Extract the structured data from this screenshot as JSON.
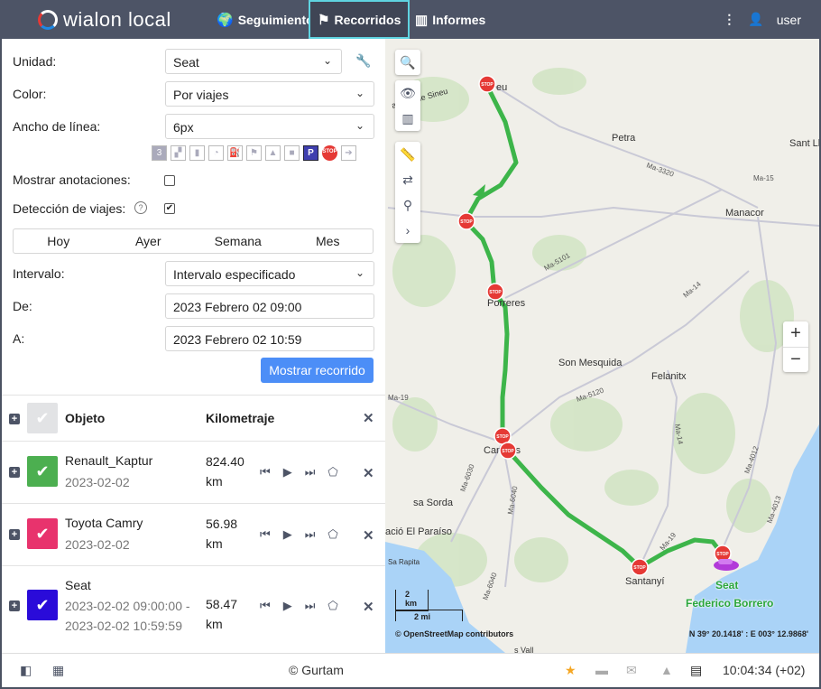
{
  "header": {
    "logo": "wialon local",
    "nav": [
      {
        "label": "Seguimiento",
        "icon": "globe-icon"
      },
      {
        "label": "Recorridos",
        "icon": "checkered-flag-icon",
        "active": true
      },
      {
        "label": "Informes",
        "icon": "report-icon"
      }
    ],
    "user": "user"
  },
  "form": {
    "unit_label": "Unidad:",
    "unit_value": "Seat",
    "color_label": "Color:",
    "color_value": "Por viajes",
    "width_label": "Ancho de línea:",
    "width_value": "6px",
    "tools": [
      "3",
      "events",
      "fuel",
      "speed",
      "fuel-station",
      "flag",
      "image",
      "video",
      "P",
      "STOP",
      "arrow"
    ],
    "annotations_label": "Mostrar anotaciones:",
    "annotations_checked": false,
    "trips_label": "Detección de viajes:",
    "trips_checked": true,
    "periods": [
      "Hoy",
      "Ayer",
      "Semana",
      "Mes"
    ],
    "interval_label": "Intervalo:",
    "interval_value": "Intervalo especificado",
    "from_label": "De:",
    "from_value": "2023 Febrero 02 09:00",
    "to_label": "A:",
    "to_value": "2023 Febrero 02 10:59",
    "submit": "Mostrar recorrido"
  },
  "table": {
    "col_object": "Objeto",
    "col_km": "Kilometraje",
    "rows": [
      {
        "name": "Renault_Kaptur",
        "date": "2023-02-02",
        "km": "824.40",
        "unit": "km",
        "color": "#4caf50"
      },
      {
        "name": "Toyota Camry",
        "date": "2023-02-02",
        "km": "56.98",
        "unit": "km",
        "color": "#e8336d"
      },
      {
        "name": "Seat",
        "date": "2023-02-02 09:00:00 -",
        "date2": "2023-02-02 10:59:59",
        "km": "58.47",
        "unit": "km",
        "color": "#2a0bd9"
      }
    ]
  },
  "map": {
    "places": [
      "Petra",
      "Sant Ll",
      "Manacor",
      "Son Mesquida",
      "Felanitx",
      "Santanyí",
      "sa Sorda",
      "ació El Paraíso",
      "Porreres",
      "Campos",
      "a vella de Sineu",
      "eu",
      "Sa Rapita",
      "s Vall"
    ],
    "roads": [
      "Ma-3320",
      "Ma-15",
      "Ma-5101",
      "Ma-14",
      "Ma-5120",
      "Ma-19",
      "Ma-6030",
      "Ma-6040",
      "Ma-4012",
      "Ma-4013",
      "Ma-14",
      "Ma-19",
      "Ma-6040"
    ],
    "stop_label": "STOP",
    "vehicle_name": "Seat",
    "driver": "Federico Borrero",
    "scale_km": "2 km",
    "scale_mi": "2 mi",
    "attribution": "© OpenStreetMap contributors",
    "coordinates": "N 39° 20.1418' : E 003° 12.9868'",
    "route_color": "#3db54a"
  },
  "footer": {
    "copyright": "© Gurtam",
    "time": "10:04:34 (+02)"
  }
}
